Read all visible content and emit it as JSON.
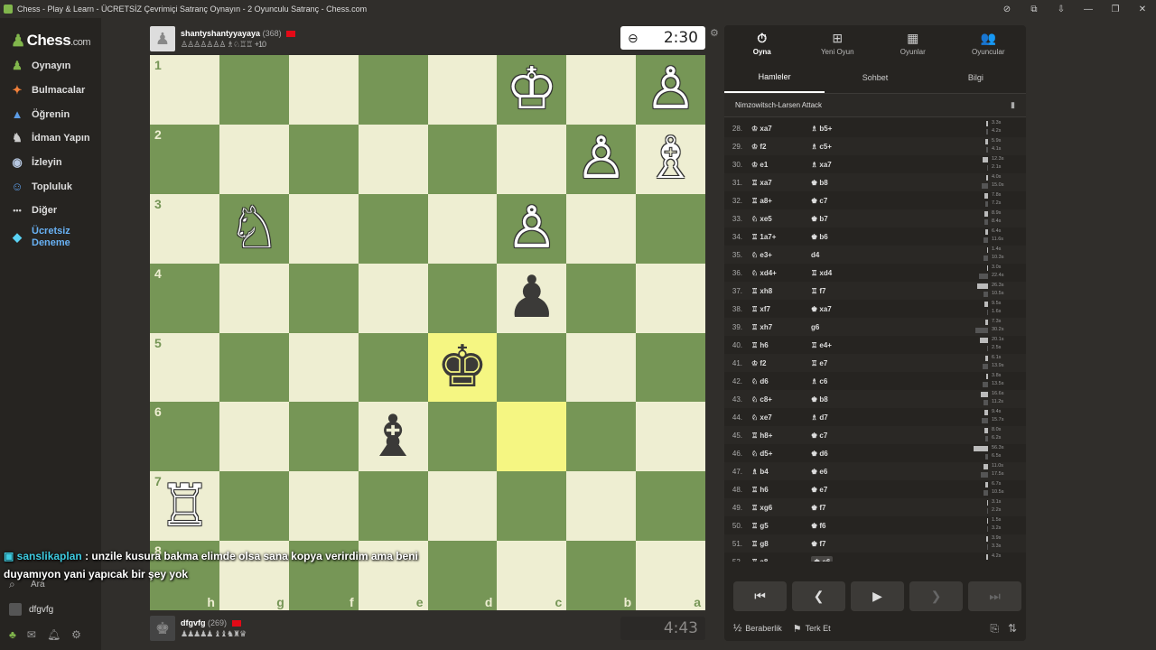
{
  "window": {
    "title": "Chess - Play & Learn - ÜCRETSİZ Çevrimiçi Satranç Oynayın - 2 Oyunculu Satranç - Chess.com"
  },
  "sidebar": {
    "logo": "Chess",
    "logo_suffix": ".com",
    "items": [
      {
        "label": "Oynayın",
        "icon": "♟"
      },
      {
        "label": "Bulmacalar",
        "icon": "✦"
      },
      {
        "label": "Öğrenin",
        "icon": "▲"
      },
      {
        "label": "İdman Yapın",
        "icon": "♞"
      },
      {
        "label": "İzleyin",
        "icon": "◉"
      },
      {
        "label": "Topluluk",
        "icon": "☺"
      },
      {
        "label": "Diğer",
        "icon": "•••"
      }
    ],
    "premium_line1": "Ücretsiz",
    "premium_line2": "Deneme",
    "search_label": "Ara",
    "username": "dfgvfg"
  },
  "top_player": {
    "name": "shantyshantyyayaya",
    "rating": "(368)",
    "captured": "♙♙♙♙♙♙♙ ♗♘♖♖",
    "advantage": "+10"
  },
  "bottom_player": {
    "name": "dfgvfg",
    "rating": "(269)",
    "captured": "♟♟♟♟♟ ♝♝♞♜♛"
  },
  "clocks": {
    "top": "2:30",
    "bottom": "4:43"
  },
  "board": {
    "ranks": [
      "1",
      "2",
      "3",
      "4",
      "5",
      "6",
      "7",
      "8"
    ],
    "files": [
      "h",
      "g",
      "f",
      "e",
      "d",
      "c",
      "b",
      "a"
    ],
    "pieces": [
      {
        "sq": "18",
        "glyph": "♙",
        "color": "w"
      },
      {
        "sq": "16",
        "glyph": "♔",
        "color": "w"
      },
      {
        "sq": "28",
        "glyph": "♗",
        "color": "w"
      },
      {
        "sq": "27",
        "glyph": "♙",
        "color": "w"
      },
      {
        "sq": "36",
        "glyph": "♙",
        "color": "w"
      },
      {
        "sq": "32",
        "glyph": "♘",
        "color": "w"
      },
      {
        "sq": "46",
        "glyph": "♟",
        "color": "b"
      },
      {
        "sq": "55",
        "glyph": "♚",
        "color": "b"
      },
      {
        "sq": "64",
        "glyph": "♝",
        "color": "b"
      },
      {
        "sq": "71",
        "glyph": "♖",
        "color": "w"
      }
    ],
    "highlights": [
      "55",
      "66"
    ]
  },
  "chat": {
    "user": "sanslikaplan",
    "message": ": unzile kusura bakma elimde olsa sana kopya verirdim ama beni duyamıyon yani yapıcak bir şey yok"
  },
  "panel": {
    "tabs": [
      {
        "label": "Oyna",
        "icon": "⏱"
      },
      {
        "label": "Yeni Oyun",
        "icon": "⊞"
      },
      {
        "label": "Oyunlar",
        "icon": "▦"
      },
      {
        "label": "Oyuncular",
        "icon": "👥"
      }
    ],
    "subtabs": [
      "Hamleler",
      "Sohbet",
      "Bilgi"
    ],
    "opening": "Nimzowitsch-Larsen Attack",
    "moves": [
      {
        "n": "28.",
        "w": "♔ xa7",
        "b": "♗ b5+",
        "tw": "3.3s",
        "tb": "4.2s",
        "ww": 2,
        "wb": 2
      },
      {
        "n": "29.",
        "w": "♔ f2",
        "b": "♗ c5+",
        "tw": "5.9s",
        "tb": "4.1s",
        "ww": 3,
        "wb": 2
      },
      {
        "n": "30.",
        "w": "♔ e1",
        "b": "♗ xa7",
        "tw": "12.3s",
        "tb": "2.1s",
        "ww": 6,
        "wb": 1
      },
      {
        "n": "31.",
        "w": "♖ xa7",
        "b": "♚ b8",
        "tw": "4.0s",
        "tb": "15.0s",
        "ww": 2,
        "wb": 7
      },
      {
        "n": "32.",
        "w": "♖ a8+",
        "b": "♚ c7",
        "tw": "7.8s",
        "tb": "7.2s",
        "ww": 4,
        "wb": 3
      },
      {
        "n": "33.",
        "w": "♘ xe5",
        "b": "♚ b7",
        "tw": "8.9s",
        "tb": "8.4s",
        "ww": 4,
        "wb": 4
      },
      {
        "n": "34.",
        "w": "♖ 1a7+",
        "b": "♚ b6",
        "tw": "6.4s",
        "tb": "11.6s",
        "ww": 3,
        "wb": 5
      },
      {
        "n": "35.",
        "w": "♘ e3+",
        "b": "d4",
        "tw": "1.4s",
        "tb": "10.3s",
        "ww": 1,
        "wb": 5
      },
      {
        "n": "36.",
        "w": "♘ xd4+",
        "b": "♖ xd4",
        "tw": "3.0s",
        "tb": "22.4s",
        "ww": 1,
        "wb": 10
      },
      {
        "n": "37.",
        "w": "♖ xh8",
        "b": "♖ f7",
        "tw": "26.3s",
        "tb": "10.5s",
        "ww": 12,
        "wb": 5
      },
      {
        "n": "38.",
        "w": "♖ xf7",
        "b": "♚ xa7",
        "tw": "9.5s",
        "tb": "1.6s",
        "ww": 4,
        "wb": 1
      },
      {
        "n": "39.",
        "w": "♖ xh7",
        "b": "g6",
        "tw": "7.3s",
        "tb": "30.2s",
        "ww": 3,
        "wb": 14
      },
      {
        "n": "40.",
        "w": "♖ h6",
        "b": "♖ e4+",
        "tw": "20.1s",
        "tb": "2.5s",
        "ww": 9,
        "wb": 1
      },
      {
        "n": "41.",
        "w": "♔ f2",
        "b": "♖ e7",
        "tw": "6.1s",
        "tb": "13.9s",
        "ww": 3,
        "wb": 6
      },
      {
        "n": "42.",
        "w": "♘ d6",
        "b": "♗ c6",
        "tw": "3.8s",
        "tb": "13.5s",
        "ww": 2,
        "wb": 6
      },
      {
        "n": "43.",
        "w": "♘ c8+",
        "b": "♚ b8",
        "tw": "16.6s",
        "tb": "11.2s",
        "ww": 8,
        "wb": 5
      },
      {
        "n": "44.",
        "w": "♘ xe7",
        "b": "♗ d7",
        "tw": "9.4s",
        "tb": "15.7s",
        "ww": 4,
        "wb": 7
      },
      {
        "n": "45.",
        "w": "♖ h8+",
        "b": "♚ c7",
        "tw": "8.0s",
        "tb": "6.2s",
        "ww": 4,
        "wb": 3
      },
      {
        "n": "46.",
        "w": "♘ d5+",
        "b": "♚ d6",
        "tw": "56.3s",
        "tb": "6.5s",
        "ww": 16,
        "wb": 3
      },
      {
        "n": "47.",
        "w": "♗ b4",
        "b": "♚ e6",
        "tw": "11.0s",
        "tb": "17.5s",
        "ww": 5,
        "wb": 8
      },
      {
        "n": "48.",
        "w": "♖ h6",
        "b": "♚ e7",
        "tw": "6.7s",
        "tb": "10.5s",
        "ww": 3,
        "wb": 5
      },
      {
        "n": "49.",
        "w": "♖ xg6",
        "b": "♚ f7",
        "tw": "3.1s",
        "tb": "2.2s",
        "ww": 1,
        "wb": 1
      },
      {
        "n": "50.",
        "w": "♖ g5",
        "b": "♚ f6",
        "tw": "1.5s",
        "tb": "3.2s",
        "ww": 1,
        "wb": 1
      },
      {
        "n": "51.",
        "w": "♖ g8",
        "b": "♚ f7",
        "tw": "3.9s",
        "tb": "3.3s",
        "ww": 2,
        "wb": 1
      },
      {
        "n": "52.",
        "w": "♖ a8",
        "b": "♚ e6",
        "tw": "4.2s",
        "tb": "2.9s",
        "ww": 2,
        "wb": 1
      }
    ],
    "controls": [
      "⏮",
      "❮",
      "▶",
      "❯",
      "⏭"
    ],
    "draw_label": "Beraberlik",
    "draw_icon": "½",
    "resign_label": "Terk Et",
    "resign_icon": "⚑"
  },
  "colors": {
    "light": "#eeeed2",
    "dark": "#769656",
    "accent": "#81b64c"
  }
}
